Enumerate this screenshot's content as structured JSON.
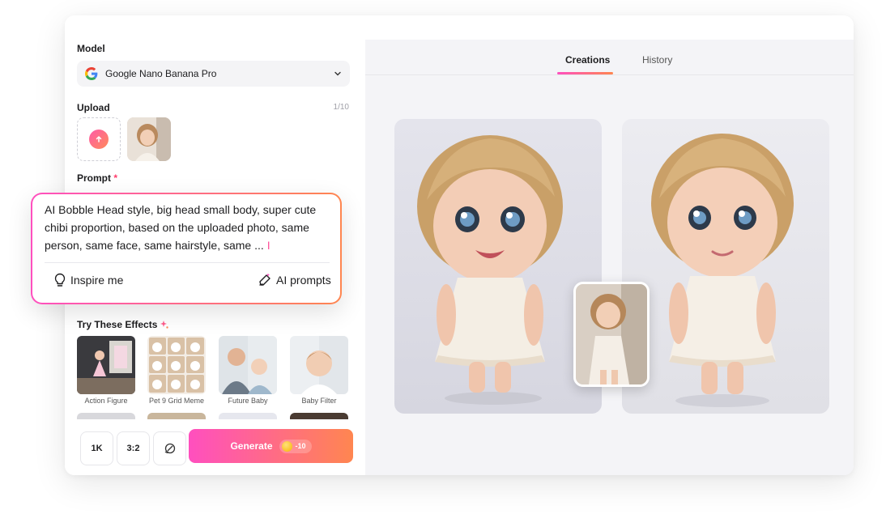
{
  "window": {
    "traffic_lights": [
      "#ff4f6e",
      "#f7b93e",
      "#3cc85f"
    ]
  },
  "model": {
    "label": "Model",
    "selected": "Google Nano Banana Pro",
    "icon": "google-g-icon"
  },
  "upload": {
    "label": "Upload",
    "count": "1/10"
  },
  "prompt": {
    "label": "Prompt",
    "required_mark": "*",
    "text": "AI Bobble Head style, big head small body, super cute chibi proportion, based on the uploaded photo, same person, same face, same hairstyle, same ...",
    "inspire_label": "Inspire me",
    "ai_prompts_label": "AI prompts"
  },
  "effects": {
    "title": "Try These Effects",
    "items": [
      {
        "caption": "Action Figure"
      },
      {
        "caption": "Pet 9 Grid Meme"
      },
      {
        "caption": "Future Baby"
      },
      {
        "caption": "Baby Filter"
      }
    ]
  },
  "controls": {
    "resolution": "1K",
    "aspect_ratio": "3:2",
    "generate_label": "Generate",
    "cost": "-10"
  },
  "tabs": [
    {
      "label": "Creations",
      "active": true
    },
    {
      "label": "History",
      "active": false
    }
  ],
  "colors": {
    "accent_start": "#ff4fbf",
    "accent_end": "#ff8650"
  }
}
